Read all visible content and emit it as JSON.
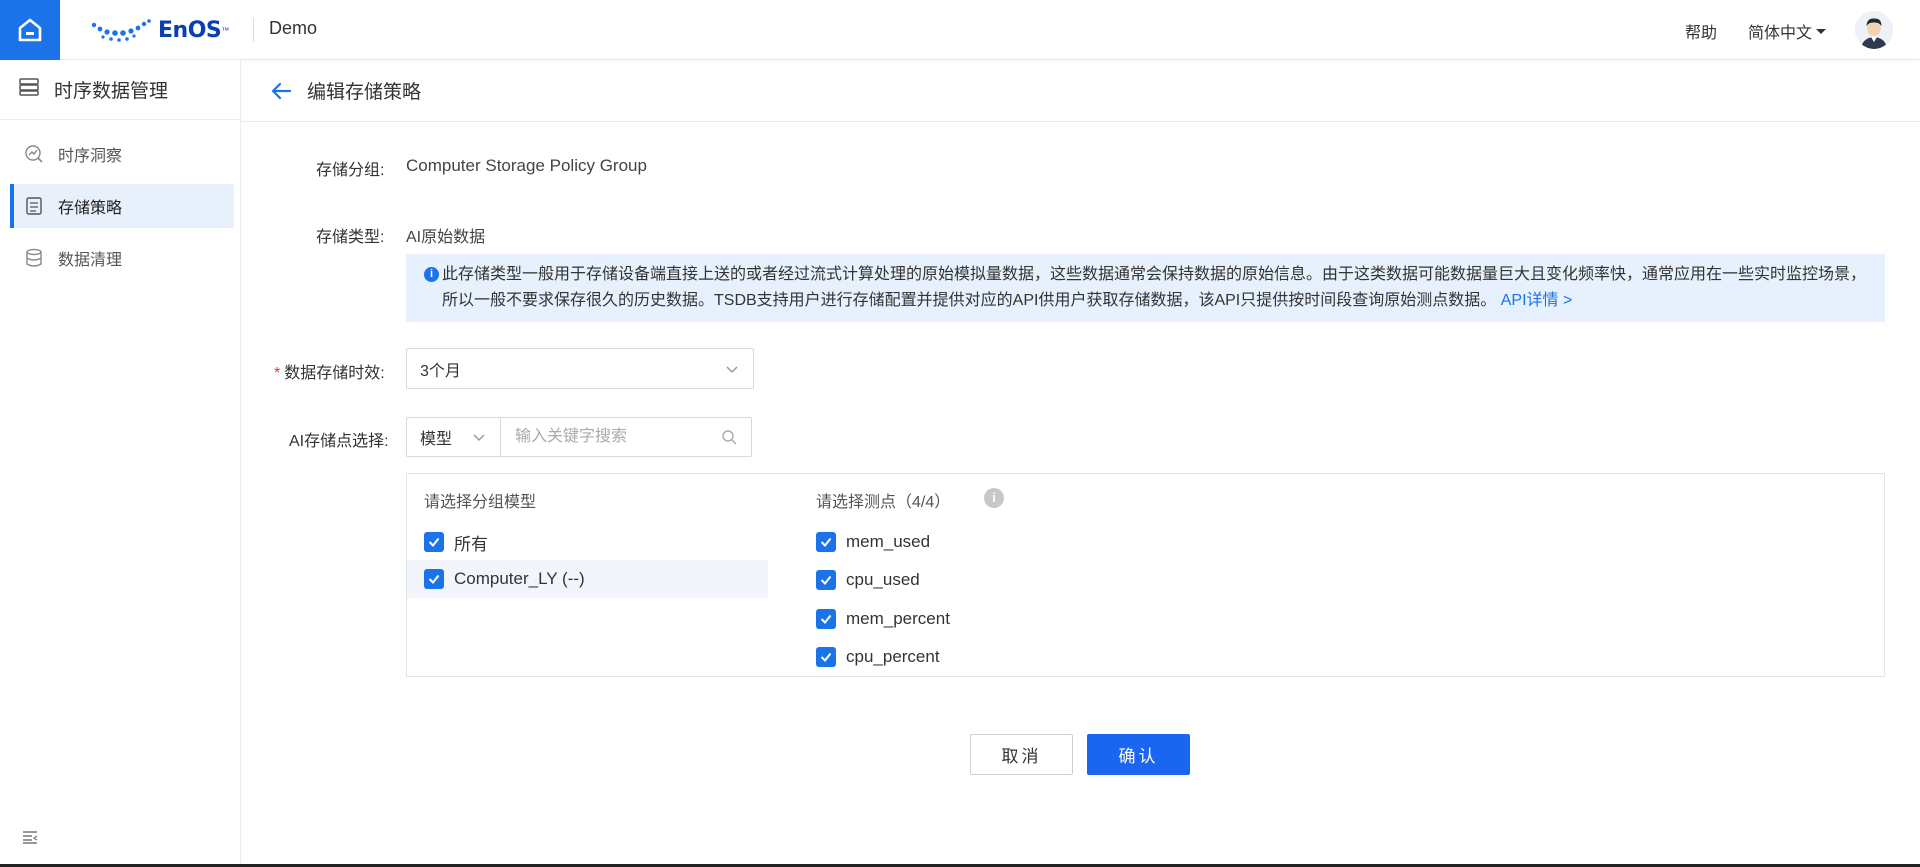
{
  "topbar": {
    "logo_text": "EnOS",
    "logo_tm": "™",
    "app_name": "Demo",
    "help": "帮助",
    "language": "简体中文"
  },
  "sidebar": {
    "title": "时序数据管理",
    "items": [
      {
        "label": "时序洞察",
        "icon": "insight-icon",
        "active": false
      },
      {
        "label": "存储策略",
        "icon": "storage-policy-icon",
        "active": true
      },
      {
        "label": "数据清理",
        "icon": "database-icon",
        "active": false
      }
    ]
  },
  "page": {
    "title": "编辑存储策略"
  },
  "form": {
    "group_label": "存储分组:",
    "group_value": "Computer Storage Policy Group",
    "type_label": "存储类型:",
    "type_value": "AI原始数据",
    "info_text": "此存储类型一般用于存储设备端直接上送的或者经过流式计算处理的原始模拟量数据，这些数据通常会保持数据的原始信息。由于这类数据可能数据量巨大且变化频率快，通常应用在一些实时监控场景，所以一般不要求保存很久的历史数据。TSDB支持用户进行存储配置并提供对应的API供用户获取存储数据，该API只提供按时间段查询原始测点数据。",
    "info_link": "API详情 >",
    "retention_label": "数据存储时效:",
    "retention_required": "*",
    "retention_value": "3个月",
    "point_label": "AI存储点选择:",
    "point_type": "模型",
    "search_placeholder": "输入关键字搜索"
  },
  "picker": {
    "models_title": "请选择分组模型",
    "models": [
      {
        "label": "所有",
        "checked": true
      },
      {
        "label": "Computer_LY (--)",
        "checked": true
      }
    ],
    "points_title": "请选择测点（4/4）",
    "points": [
      {
        "label": "mem_used",
        "checked": true
      },
      {
        "label": "cpu_used",
        "checked": true
      },
      {
        "label": "mem_percent",
        "checked": true
      },
      {
        "label": "cpu_percent",
        "checked": true
      }
    ],
    "help_glyph": "i"
  },
  "actions": {
    "cancel": "取消",
    "confirm": "确认"
  },
  "colors": {
    "primary": "#1a73e8",
    "info_bg": "#e6f1fd",
    "required": "#e53935"
  }
}
